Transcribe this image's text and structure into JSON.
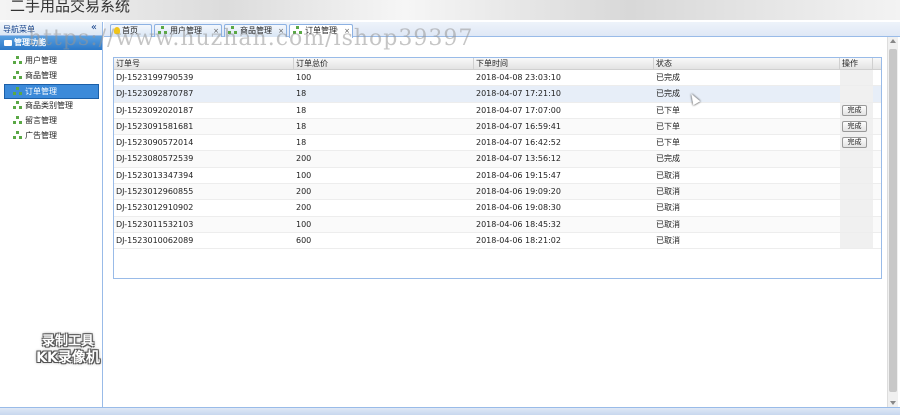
{
  "app": {
    "title": "二手用品交易系统"
  },
  "watermark": "https://www.huzhan.com/ishop39397",
  "sidebar": {
    "header": "导航菜单",
    "collapse_glyph": "«",
    "panel_title": "管理功能",
    "items": [
      {
        "label": "用户管理",
        "active": false
      },
      {
        "label": "商品管理",
        "active": false
      },
      {
        "label": "订单管理",
        "active": true
      },
      {
        "label": "商品类别管理",
        "active": false
      },
      {
        "label": "留言管理",
        "active": false
      },
      {
        "label": "广告管理",
        "active": false
      }
    ]
  },
  "tabs": [
    {
      "label": "首页",
      "icon": "bulb-icon",
      "closable": false
    },
    {
      "label": "用户管理",
      "icon": "tree-icon",
      "closable": true
    },
    {
      "label": "商品管理",
      "icon": "tree-icon",
      "closable": true
    },
    {
      "label": "订单管理",
      "icon": "tree-icon",
      "closable": true,
      "active": true
    }
  ],
  "close_glyph": "×",
  "grid": {
    "columns": [
      "订单号",
      "订单总价",
      "下单时间",
      "状态",
      "操作"
    ],
    "action_label": "完成",
    "rows": [
      {
        "id": "DJ-1523199790539",
        "total": "100",
        "time": "2018-04-08 23:03:10",
        "status": "已完成",
        "action": false
      },
      {
        "id": "DJ-1523092870787",
        "total": "18",
        "time": "2018-04-07 17:21:10",
        "status": "已完成",
        "action": false
      },
      {
        "id": "DJ-1523092020187",
        "total": "18",
        "time": "2018-04-07 17:07:00",
        "status": "已下单",
        "action": true
      },
      {
        "id": "DJ-1523091581681",
        "total": "18",
        "time": "2018-04-07 16:59:41",
        "status": "已下单",
        "action": true
      },
      {
        "id": "DJ-1523090572014",
        "total": "18",
        "time": "2018-04-07 16:42:52",
        "status": "已下单",
        "action": true
      },
      {
        "id": "DJ-1523080572539",
        "total": "200",
        "time": "2018-04-07 13:56:12",
        "status": "已完成",
        "action": false
      },
      {
        "id": "DJ-1523013347394",
        "total": "100",
        "time": "2018-04-06 19:15:47",
        "status": "已取消",
        "action": false
      },
      {
        "id": "DJ-1523012960855",
        "total": "200",
        "time": "2018-04-06 19:09:20",
        "status": "已取消",
        "action": false
      },
      {
        "id": "DJ-1523012910902",
        "total": "200",
        "time": "2018-04-06 19:08:30",
        "status": "已取消",
        "action": false
      },
      {
        "id": "DJ-1523011532103",
        "total": "100",
        "time": "2018-04-06 18:45:32",
        "status": "已取消",
        "action": false
      },
      {
        "id": "DJ-1523010062089",
        "total": "600",
        "time": "2018-04-06 18:21:02",
        "status": "已取消",
        "action": false
      }
    ]
  },
  "recorder_badge": {
    "line1": "录制工具",
    "line2": "KK录像机"
  }
}
